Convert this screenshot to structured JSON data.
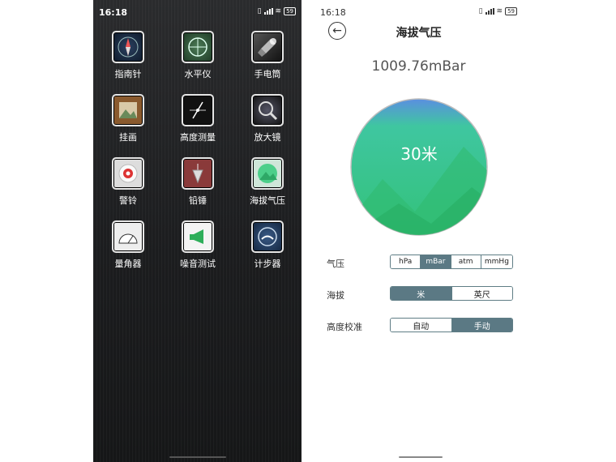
{
  "status_bar": {
    "time": "16:18",
    "battery": "59"
  },
  "home": {
    "apps": [
      {
        "label": "指南针",
        "icon": "compass-icon"
      },
      {
        "label": "水平仪",
        "icon": "level-icon"
      },
      {
        "label": "手电筒",
        "icon": "flashlight-icon"
      },
      {
        "label": "挂画",
        "icon": "picture-icon"
      },
      {
        "label": "高度测量",
        "icon": "height-measure-icon"
      },
      {
        "label": "放大镜",
        "icon": "magnifier-icon"
      },
      {
        "label": "警铃",
        "icon": "alarm-bell-icon"
      },
      {
        "label": "铅锤",
        "icon": "plumb-bob-icon"
      },
      {
        "label": "海拔气压",
        "icon": "altitude-pressure-icon"
      },
      {
        "label": "量角器",
        "icon": "protractor-icon"
      },
      {
        "label": "噪音测试",
        "icon": "megaphone-icon"
      },
      {
        "label": "计步器",
        "icon": "pedometer-icon"
      }
    ]
  },
  "altimeter": {
    "title": "海拔气压",
    "pressure": "1009.76mBar",
    "altitude": "30米",
    "pressure_row": {
      "label": "气压",
      "options": [
        "hPa",
        "mBar",
        "atm",
        "mmHg"
      ],
      "selected": "mBar"
    },
    "altitude_row": {
      "label": "海拔",
      "options": [
        "米",
        "英尺"
      ],
      "selected": "米"
    },
    "calibration_row": {
      "label": "高度校准",
      "options": [
        "自动",
        "手动"
      ],
      "selected": "手动"
    },
    "colors": {
      "accent": "#5b7984",
      "gauge_green": "#33c27a",
      "gauge_blue": "#5b8fe0"
    }
  }
}
